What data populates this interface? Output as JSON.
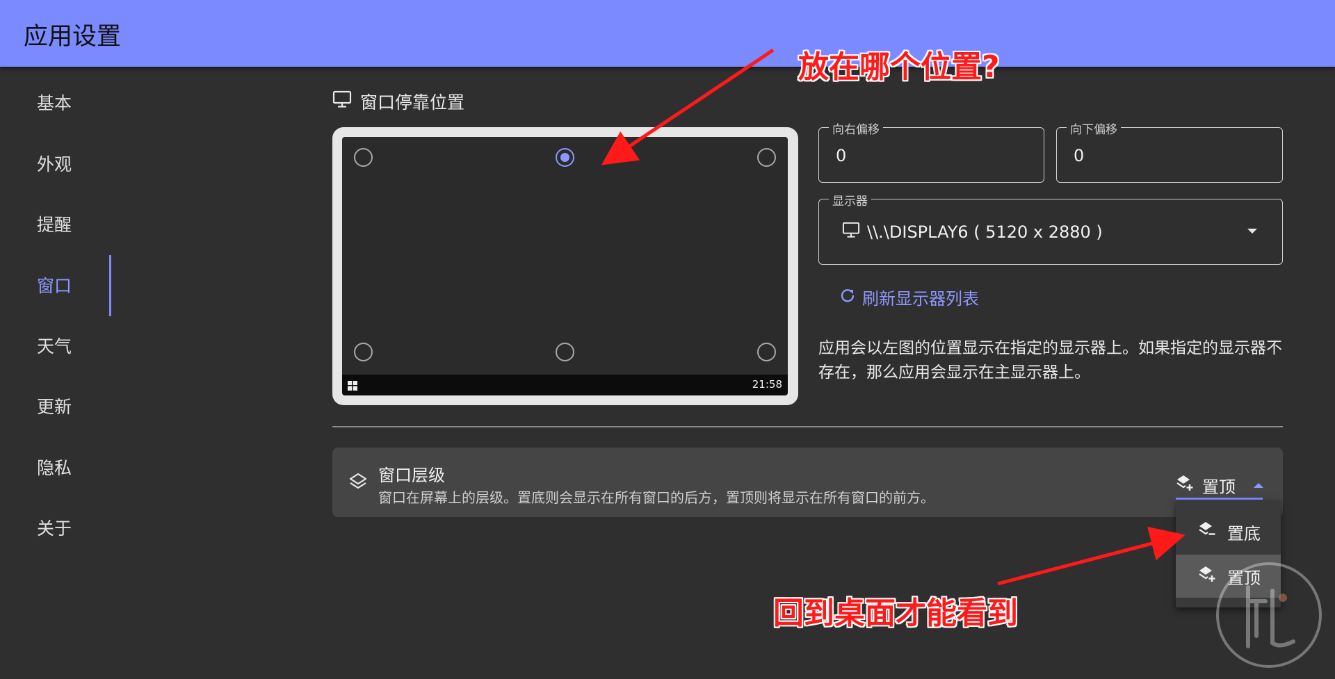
{
  "header": {
    "title": "应用设置"
  },
  "sidebar": {
    "items": [
      {
        "label": "基本"
      },
      {
        "label": "外观"
      },
      {
        "label": "提醒"
      },
      {
        "label": "窗口",
        "active": true
      },
      {
        "label": "天气"
      },
      {
        "label": "更新"
      },
      {
        "label": "隐私"
      },
      {
        "label": "关于"
      }
    ]
  },
  "dock": {
    "title": "窗口停靠位置",
    "selected_position": "top-center",
    "taskbar_time": "21:58"
  },
  "offsets": {
    "right": {
      "label": "向右偏移",
      "value": "0"
    },
    "down": {
      "label": "向下偏移",
      "value": "0"
    }
  },
  "display": {
    "label": "显示器",
    "value": "\\\\.\\DISPLAY6 ( 5120 x 2880 )",
    "refresh_label": "刷新显示器列表",
    "description": "应用会以左图的位置显示在指定的显示器上。如果指定的显示器不存在，那么应用会显示在主显示器上。"
  },
  "layer": {
    "title": "窗口层级",
    "subtitle": "窗口在屏幕上的层级。置底则会显示在所有窗口的后方，置顶则将显示在所有窗口的前方。",
    "selected": "置顶",
    "options": [
      {
        "label": "置底"
      },
      {
        "label": "置顶"
      }
    ]
  },
  "annotations": {
    "top": "放在哪个位置?",
    "bottom": "回到桌面才能看到"
  },
  "colors": {
    "header": "#7b8aff",
    "accent": "#8c98ff",
    "background": "#2f2f2f",
    "annotation": "#ff1a1a"
  }
}
